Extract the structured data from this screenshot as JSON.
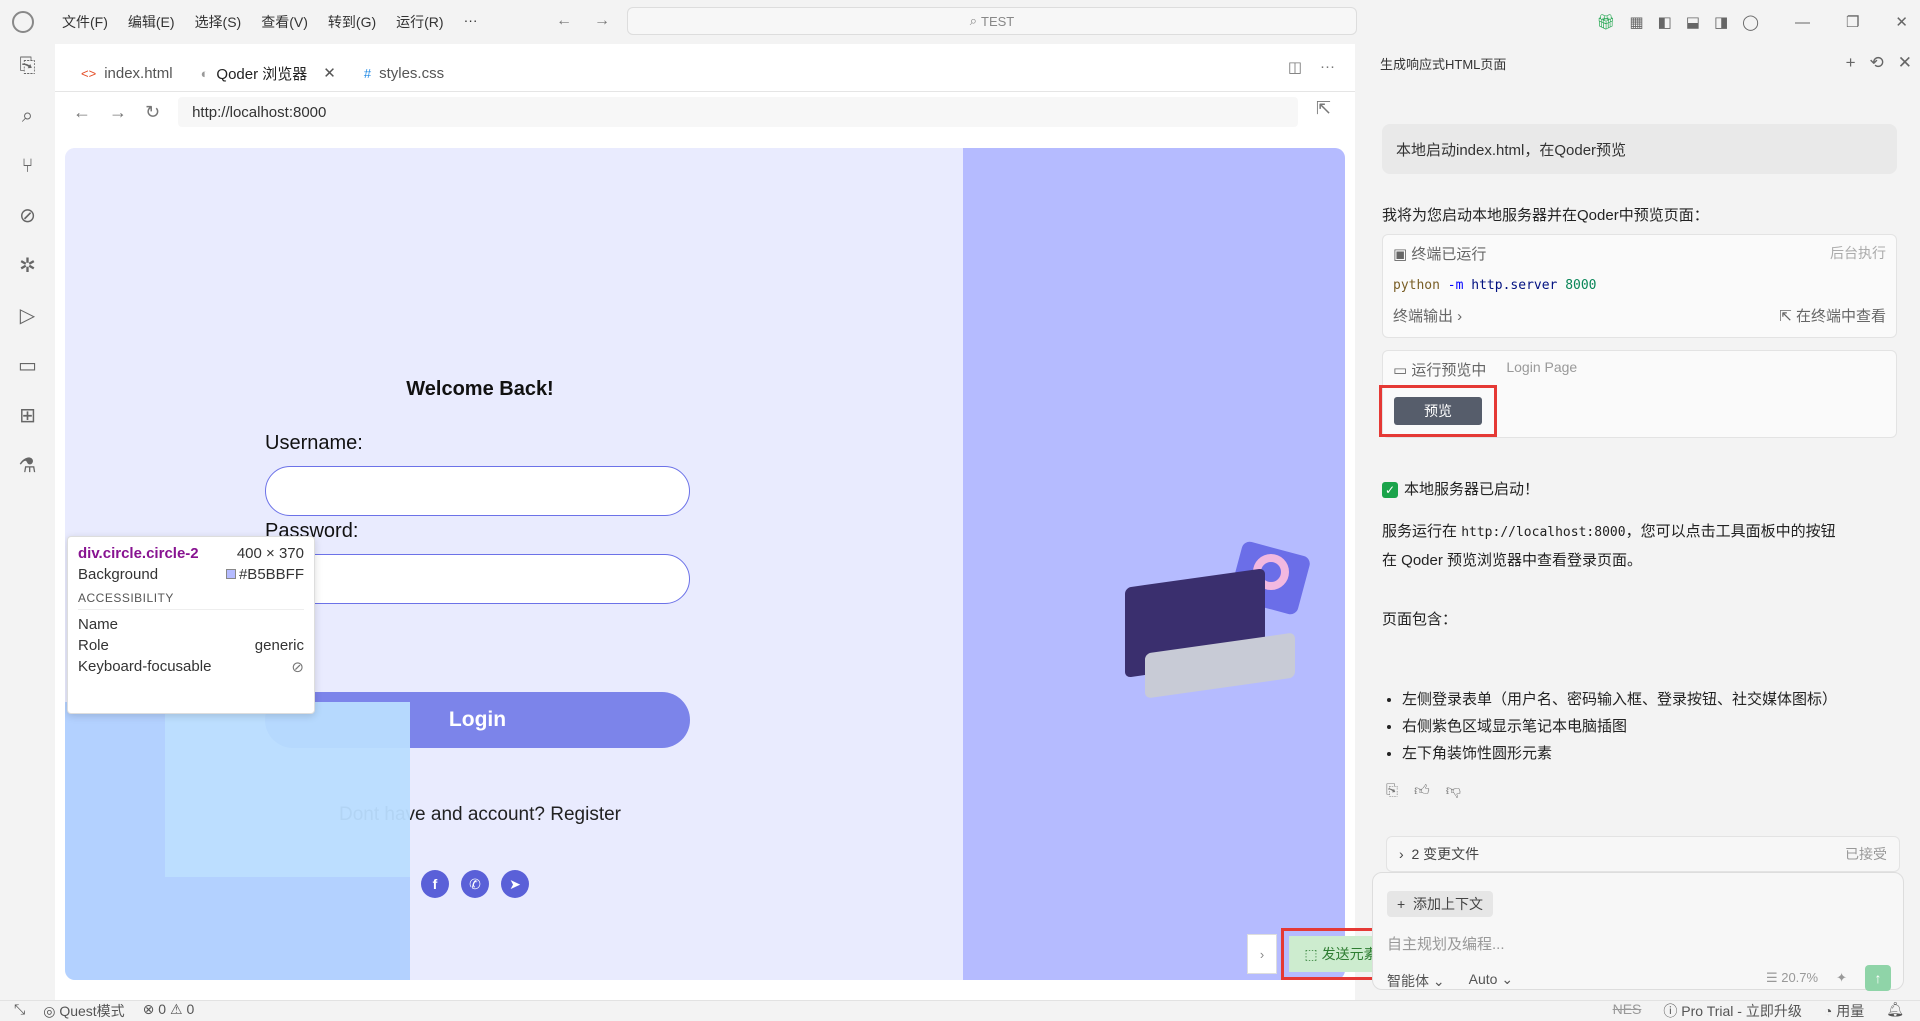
{
  "titlebar": {
    "menus": [
      "文件(F)",
      "编辑(E)",
      "选择(S)",
      "查看(V)",
      "转到(G)",
      "运行(R)",
      "···"
    ],
    "search_text": "TEST"
  },
  "editor": {
    "tabs": [
      {
        "label": "index.html",
        "icon": "<>"
      },
      {
        "label": "Qoder 浏览器",
        "icon": "◐"
      },
      {
        "label": "styles.css",
        "icon": "#"
      }
    ],
    "url": "http://localhost:8000"
  },
  "page": {
    "welcome": "Welcome Back!",
    "username_label": "Username:",
    "password_label": "Password:",
    "login_label": "Login",
    "register_text": "Dont have and account? Register",
    "background_color": "#B5BBFF"
  },
  "inspector": {
    "selector": "div.circle.circle-2",
    "size": "400 × 370",
    "background_label": "Background",
    "background_value": "#B5BBFF",
    "section": "ACCESSIBILITY",
    "name_label": "Name",
    "role_label": "Role",
    "role_value": "generic",
    "focus_label": "Keyboard-focusable"
  },
  "send_element": "发送元素",
  "chat": {
    "title": "生成响应式HTML页面",
    "user_message": "本地启动index.html，在Qoder预览",
    "intro": "我将为您启动本地服务器并在Qoder中预览页面：",
    "terminal": {
      "status": "终端已运行",
      "mode": "后台执行",
      "cmd": "python",
      "flag": "-m",
      "module": "http.server",
      "port": "8000",
      "output_label": "终端输出",
      "view_label": "在终端中查看"
    },
    "preview": {
      "status": "运行预览中",
      "title": "Login Page",
      "button": "预览"
    },
    "server_started": "本地服务器已启动！",
    "service_line_a": "服务运行在",
    "service_url": "http://localhost:8000",
    "service_line_b": "，您可以点击工具面板中的按钮",
    "service_line_c": "在 Qoder 预览浏览器中查看登录页面。",
    "contains": "页面包含：",
    "items": [
      "左侧登录表单（用户名、密码输入框、登录按钮、社交媒体图标）",
      "右侧紫色区域显示笔记本电脑插图",
      "左下角装饰性圆形元素"
    ],
    "changes_label": "2 变更文件",
    "changes_status": "已接受",
    "add_context": "添加上下文",
    "placeholder": "自主规划及编程...",
    "mode": "智能体",
    "model": "Auto",
    "usage": "20.7%"
  },
  "statusbar": {
    "mode": "Quest模式",
    "errors": "0",
    "warnings": "0",
    "nes": "NES",
    "pro": "Pro Trial - 立即升级",
    "usage": "用量"
  }
}
